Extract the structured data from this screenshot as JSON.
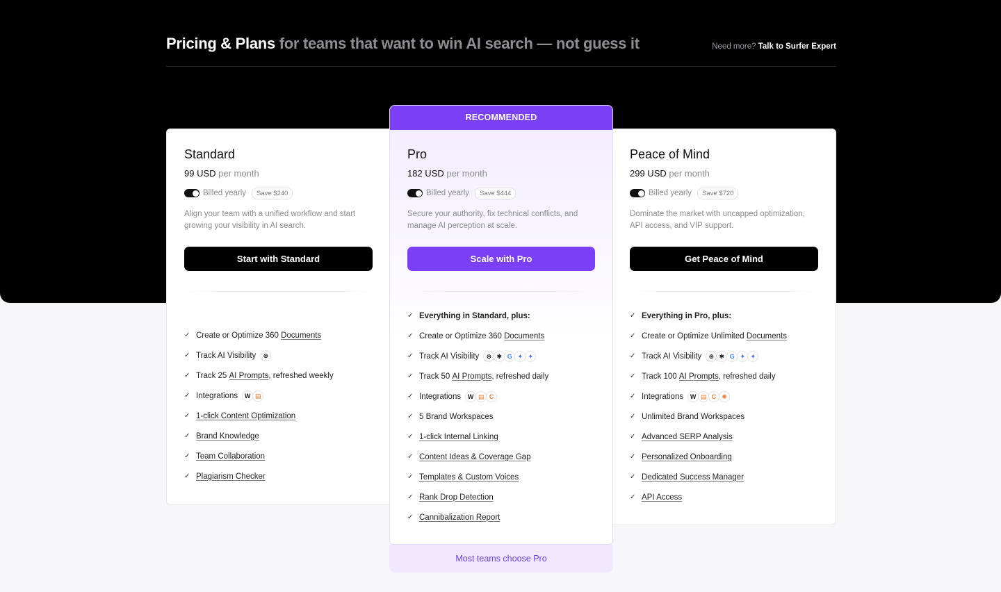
{
  "header": {
    "title_main": "Pricing & Plans",
    "title_rest": "for teams that want to win AI search — not guess it",
    "need_more_prefix": "Need more?",
    "need_more_link": "Talk to Surfer Expert"
  },
  "plans": [
    {
      "name": "Standard",
      "price": "99 USD",
      "period": "per month",
      "billing": "Billed yearly",
      "save": "Save $240",
      "description": "Align your team with a unified workflow and start growing your visibility in AI search.",
      "cta": "Start with Standard",
      "features": [
        {
          "pre": "Create or Optimize 360 ",
          "link": "Documents"
        },
        {
          "pre": "Track AI Visibility",
          "icons": [
            "openai-icon"
          ]
        },
        {
          "pre": "Track 25 ",
          "link": "AI Prompts",
          "post": ", refreshed weekly"
        },
        {
          "pre": "Integrations",
          "icons": [
            "wordpress-icon",
            "google-docs-icon"
          ]
        },
        {
          "link": "1-click Content Optimization"
        },
        {
          "link": "Brand Knowledge"
        },
        {
          "link": "Team Collaboration"
        },
        {
          "link": "Plagiarism Checker"
        }
      ]
    },
    {
      "name": "Pro",
      "badge": "RECOMMENDED",
      "price": "182 USD",
      "period": "per month",
      "billing": "Billed yearly",
      "save": "Save $444",
      "description": "Secure your authority, fix technical conflicts, and manage AI perception at scale.",
      "cta": "Scale with Pro",
      "footer": "Most teams choose Pro",
      "features": [
        {
          "pre": "Everything in Standard, plus:",
          "lead": true
        },
        {
          "pre": "Create or Optimize 360 ",
          "link": "Documents"
        },
        {
          "pre": "Track AI Visibility",
          "icons": [
            "openai-icon",
            "perplexity-icon",
            "google-icon",
            "gemini-icon",
            "ai-mode-icon"
          ]
        },
        {
          "pre": "Track 50 ",
          "link": "AI Prompts",
          "post": ", refreshed daily"
        },
        {
          "pre": "Integrations",
          "icons": [
            "wordpress-icon",
            "google-docs-icon",
            "contentful-icon"
          ]
        },
        {
          "pre": "5 Brand Workspaces"
        },
        {
          "link": "1-click Internal Linking"
        },
        {
          "link": "Content Ideas & Coverage Gap"
        },
        {
          "link": "Templates & Custom Voices"
        },
        {
          "link": "Rank Drop Detection"
        },
        {
          "link": "Cannibalization Report"
        }
      ]
    },
    {
      "name": "Peace of Mind",
      "price": "299 USD",
      "period": "per month",
      "billing": "Billed yearly",
      "save": "Save $720",
      "description": "Dominate the market with uncapped optimization, API access, and VIP support.",
      "cta": "Get Peace of Mind",
      "features": [
        {
          "pre": "Everything in Pro, plus:",
          "lead": true
        },
        {
          "pre": "Create or Optimize Unlimited ",
          "link": "Documents"
        },
        {
          "pre": "Track AI Visibility",
          "icons": [
            "openai-icon",
            "perplexity-icon",
            "google-icon",
            "gemini-icon",
            "ai-mode-icon"
          ]
        },
        {
          "pre": "Track 100 ",
          "link": "AI Prompts",
          "post": ", refreshed daily"
        },
        {
          "pre": "Integrations",
          "icons": [
            "wordpress-icon",
            "google-docs-icon",
            "contentful-icon",
            "hubspot-icon"
          ]
        },
        {
          "pre": "Unlimited Brand Workspaces"
        },
        {
          "link": "Advanced SERP Analysis"
        },
        {
          "link": "Personalized Onboarding"
        },
        {
          "link": "Dedicated Success Manager"
        },
        {
          "link": "API Access"
        }
      ]
    }
  ],
  "colors": {
    "accent": "#7b3ff6",
    "hero_bg": "#000000",
    "page_bg": "#f7f6f8"
  }
}
